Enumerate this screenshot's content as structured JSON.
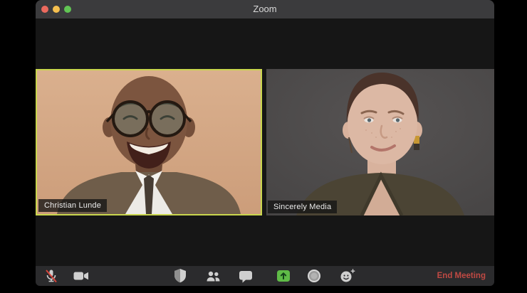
{
  "window": {
    "title": "Zoom",
    "traffic_lights": [
      {
        "name": "close"
      },
      {
        "name": "minimize"
      },
      {
        "name": "zoom"
      }
    ]
  },
  "participants": [
    {
      "name": "Christian Lunde",
      "active_speaker": true
    },
    {
      "name": "Sincerely Media",
      "active_speaker": false
    }
  ],
  "toolbar": {
    "buttons": [
      {
        "id": "mute",
        "icon": "microphone-muted-icon",
        "state": "muted"
      },
      {
        "id": "video",
        "icon": "video-camera-icon",
        "state": "on"
      },
      {
        "id": "security",
        "icon": "security-shield-icon"
      },
      {
        "id": "participants",
        "icon": "participants-icon"
      },
      {
        "id": "chat",
        "icon": "chat-bubble-icon"
      },
      {
        "id": "share-screen",
        "icon": "share-screen-icon",
        "accent": "green"
      },
      {
        "id": "record",
        "icon": "record-icon"
      },
      {
        "id": "reactions",
        "icon": "reactions-smiley-icon"
      }
    ],
    "end_meeting_label": "End Meeting"
  },
  "colors": {
    "active_speaker_border": "#c9d64d",
    "share_screen_green": "#5fbb47",
    "end_meeting_red": "#bf4943",
    "mute_slash_red": "#d8453c",
    "titlebar_bg": "#3b3b3d",
    "toolbar_bg": "#2b2b2d",
    "video_area_bg": "#161616",
    "traffic_red": "#ec6a5e",
    "traffic_yellow": "#f5bf4f",
    "traffic_green": "#61c554"
  }
}
